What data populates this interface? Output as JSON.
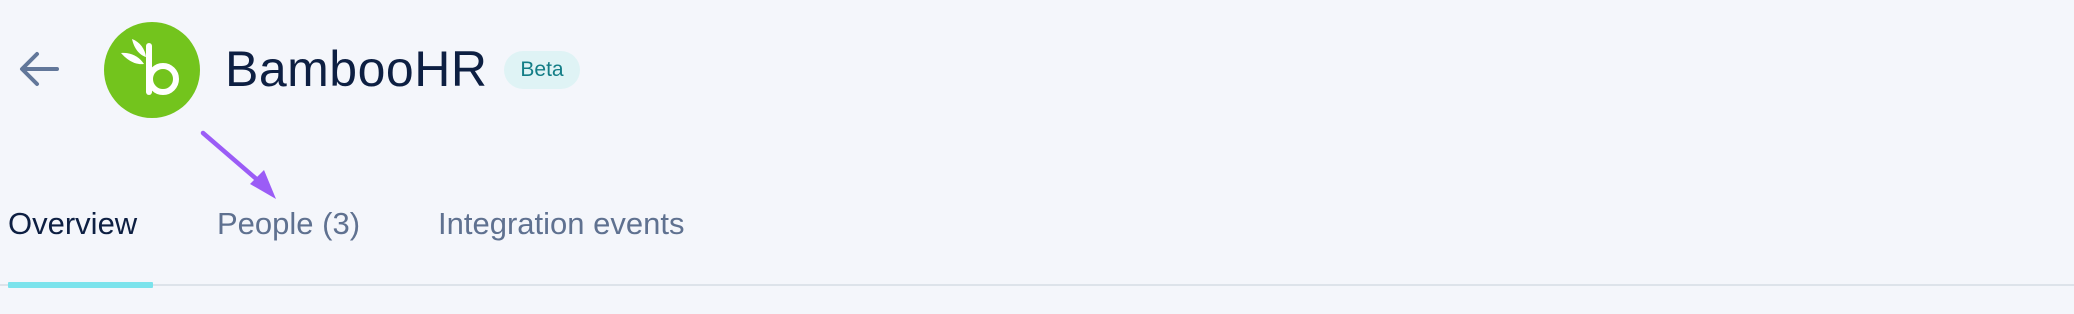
{
  "header": {
    "back_icon": "arrow-left-icon",
    "logo_icon": "bamboohr-logo",
    "title": "BambooHR",
    "badge": "Beta",
    "logo_color": "#73c41d"
  },
  "annotation": {
    "icon": "arrow-pointer-annotation",
    "color": "#9b5cf6"
  },
  "tabs": [
    {
      "label": "Overview",
      "active": true
    },
    {
      "label": "People (3)",
      "active": false
    },
    {
      "label": "Integration events",
      "active": false
    }
  ],
  "colors": {
    "active_tab_underline": "#7be3ec",
    "badge_background": "#dff3f5",
    "badge_text": "#137d86"
  }
}
